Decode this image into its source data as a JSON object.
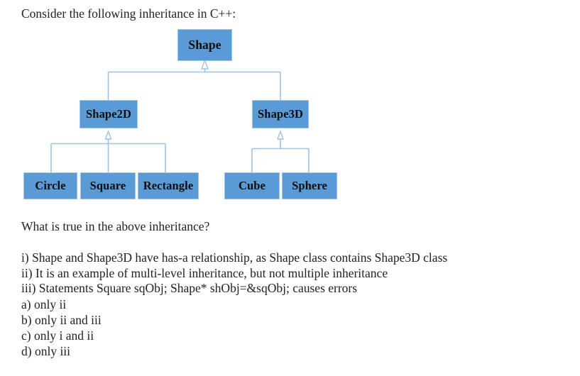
{
  "intro": "Consider the following inheritance in C++:",
  "diagram": {
    "title": "class-inheritance-hierarchy",
    "relationship": "generalization",
    "box_fill": "#5B9BD5",
    "box_border": "#9DC3E6",
    "connector_color": "#9DC3E6",
    "nodes": {
      "shape": "Shape",
      "shape2d": "Shape2D",
      "shape3d": "Shape3D",
      "circle": "Circle",
      "square": "Square",
      "rectangle": "Rectangle",
      "cube": "Cube",
      "sphere": "Sphere"
    },
    "edges": [
      {
        "from": "Shape2D",
        "to": "Shape"
      },
      {
        "from": "Shape3D",
        "to": "Shape"
      },
      {
        "from": "Circle",
        "to": "Shape2D"
      },
      {
        "from": "Square",
        "to": "Shape2D"
      },
      {
        "from": "Rectangle",
        "to": "Shape2D"
      },
      {
        "from": "Cube",
        "to": "Shape3D"
      },
      {
        "from": "Sphere",
        "to": "Shape3D"
      }
    ]
  },
  "question": "What is true in the above inheritance?",
  "statements": [
    "i) Shape and Shape3D have has-a relationship, as Shape class contains Shape3D class",
    "ii) It is an example of multi-level inheritance, but not multiple inheritance",
    "iii) Statements Square sqObj; Shape* shObj=&sqObj; causes errors"
  ],
  "options": [
    "a) only ii",
    "b) only ii and iii",
    "c) only i and ii",
    "d) only iii"
  ]
}
